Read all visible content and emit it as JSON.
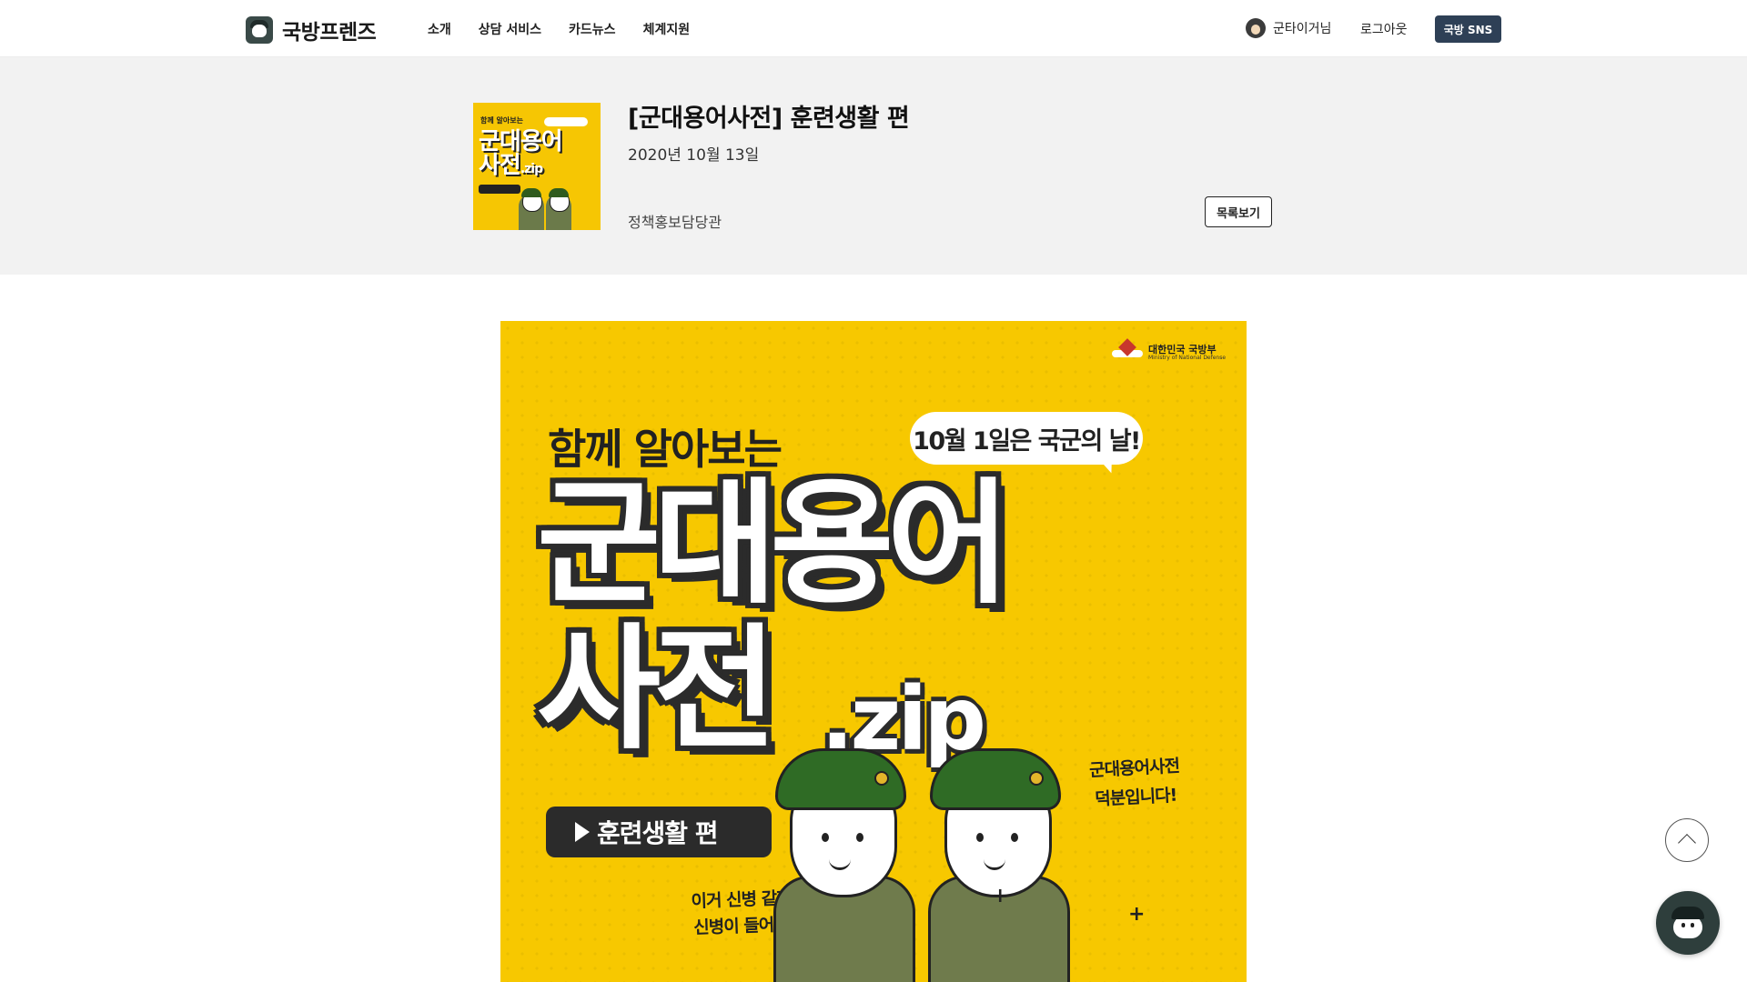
{
  "header": {
    "logo_text": "국방프렌즈",
    "nav": [
      "소개",
      "상담 서비스",
      "카드뉴스",
      "체계지원"
    ],
    "user_name": "군타이거님",
    "logout_label": "로그아웃",
    "sns_label": "국방 SNS"
  },
  "post": {
    "title": "[군대용어사전] 훈련생활 편",
    "date": "2020년 10월 13일",
    "author": "정책홍보담당관",
    "list_button": "목록보기"
  },
  "card": {
    "ministry": "대한민국 국방부",
    "ministry_en": "Ministry of National Defense",
    "subtitle": "함께 알아보는",
    "bubble": "10월 1일은 국군의 날!",
    "headline_line1": "군대용어",
    "headline_line2": "사전",
    "headline_ext": ".zip",
    "tag": "훈련생활 편",
    "speech_left_1": "이거 신병 같지 않은",
    "speech_left_2": "신병이 들어왔구만!",
    "speech_right_1": "군대용어사전",
    "speech_right_2": "덕분입니다!"
  },
  "icons": {
    "scroll_top": "chevron-up-icon",
    "chat": "chatbot-icon"
  },
  "colors": {
    "accent": "#2e4056",
    "card_yellow": "#f7c800",
    "band_gray": "#f2f2f2"
  }
}
